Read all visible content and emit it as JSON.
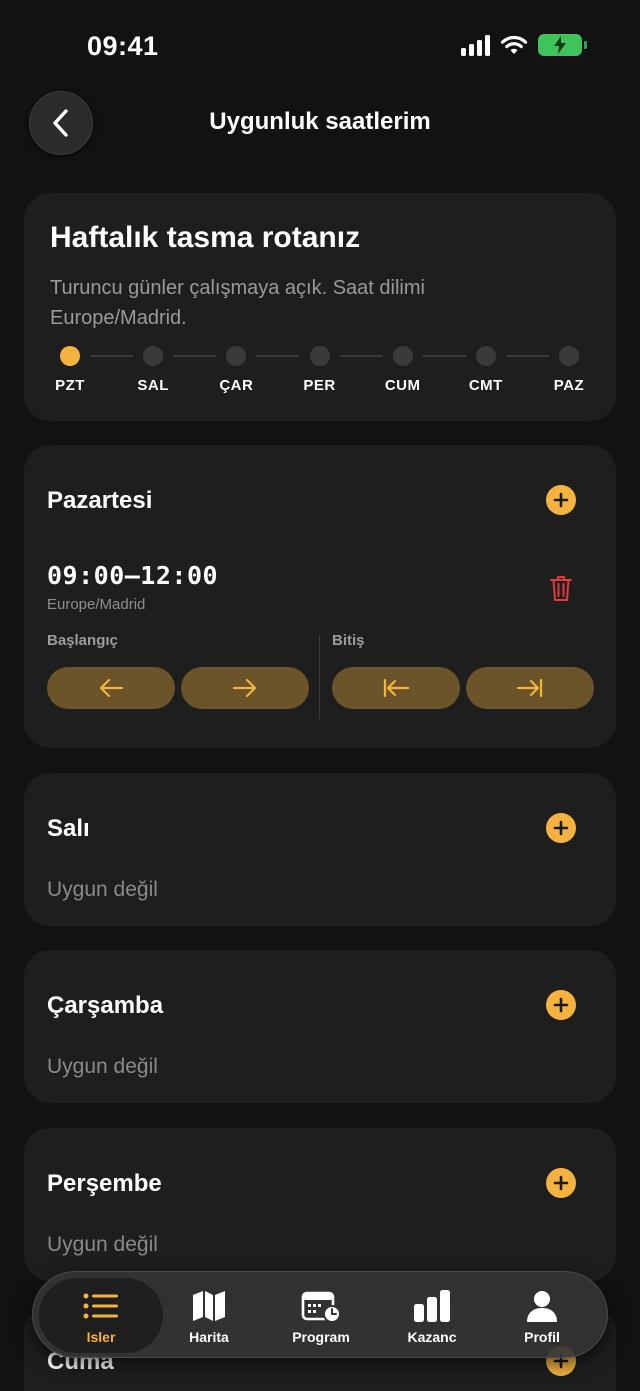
{
  "status_bar": {
    "time": "09:41"
  },
  "header": {
    "title": "Uygunluk saatlerim"
  },
  "weekly": {
    "title": "Haftalık tasma rotanız",
    "description": "Turuncu günler çalışmaya açık. Saat dilimi Europe/Madrid.",
    "days": [
      {
        "label": "PZT",
        "active": true
      },
      {
        "label": "SAL",
        "active": false
      },
      {
        "label": "ÇAR",
        "active": false
      },
      {
        "label": "PER",
        "active": false
      },
      {
        "label": "CUM",
        "active": false
      },
      {
        "label": "CMT",
        "active": false
      },
      {
        "label": "PAZ",
        "active": false
      }
    ]
  },
  "days": {
    "monday": {
      "title": "Pazartesi",
      "slot": {
        "time": "09:00–12:00",
        "timezone": "Europe/Madrid"
      },
      "start_label": "Başlangıç",
      "end_label": "Bitiş"
    },
    "tuesday": {
      "title": "Salı",
      "status": "Uygun değil"
    },
    "wednesday": {
      "title": "Çarşamba",
      "status": "Uygun değil"
    },
    "thursday": {
      "title": "Perşembe",
      "status": "Uygun değil"
    },
    "friday": {
      "title": "Cuma"
    }
  },
  "tabs": [
    {
      "label": "Isler",
      "icon": "list-icon",
      "active": true
    },
    {
      "label": "Harita",
      "icon": "map-icon",
      "active": false
    },
    {
      "label": "Program",
      "icon": "calendar-clock-icon",
      "active": false
    },
    {
      "label": "Kazanc",
      "icon": "bar-chart-icon",
      "active": false
    },
    {
      "label": "Profil",
      "icon": "person-icon",
      "active": false
    }
  ],
  "colors": {
    "accent": "#f6b23f",
    "background": "#121212",
    "card": "#1e1e1f",
    "danger": "#e53935",
    "adjust_button": "#6b5429",
    "battery": "#3ec45a"
  }
}
